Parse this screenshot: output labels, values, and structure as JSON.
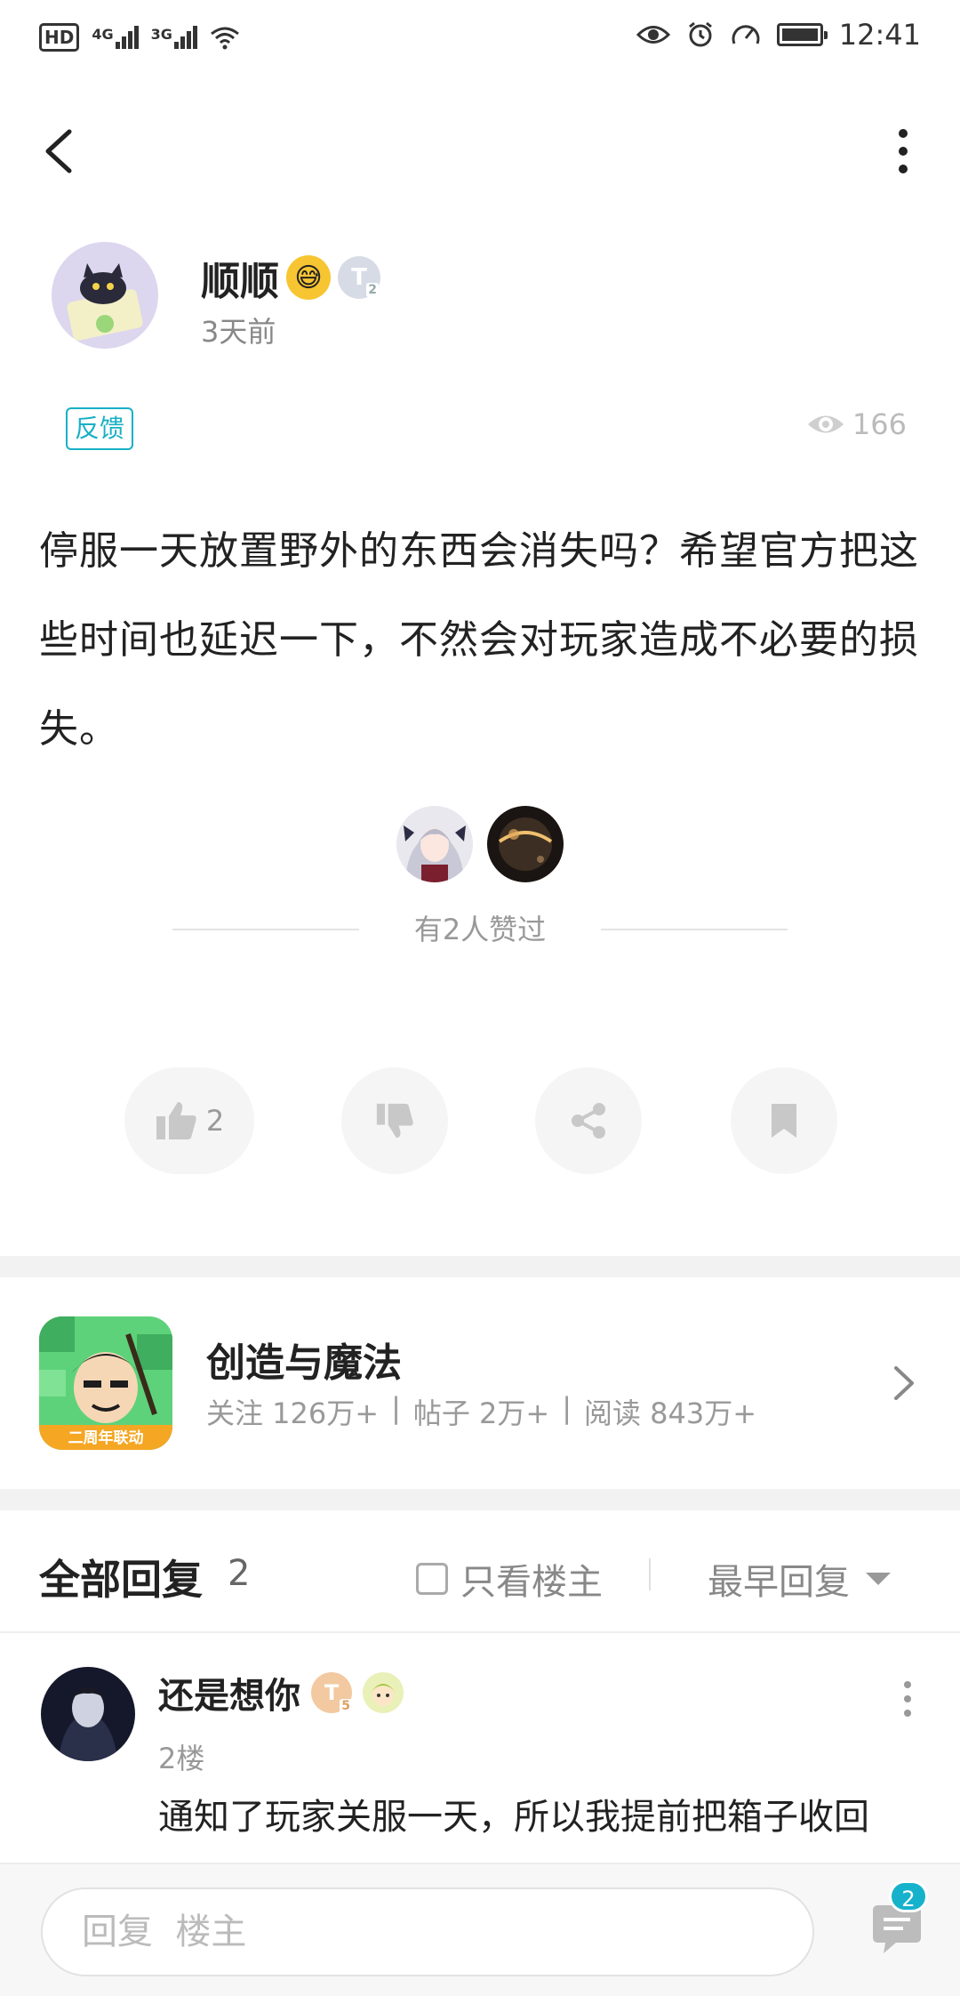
{
  "status_bar": {
    "hd": "HD",
    "sim1": "4G",
    "sim2": "3G",
    "time": "12:41"
  },
  "post": {
    "author_name": "顺顺",
    "author_emoji": "😅",
    "author_level": "T",
    "author_level_sub": "2",
    "time_ago": "3天前",
    "tag": "反馈",
    "views": "166",
    "body": "停服一天放置野外的东西会消失吗？希望官方把这些时间也延迟一下，不然会对玩家造成不必要的损失。",
    "liked_text": "有2人赞过",
    "like_count": "2"
  },
  "game": {
    "title": "创造与魔法",
    "icon_caption": "二周年联动",
    "stats": [
      "关注 126万+",
      "|",
      "帖子 2万+",
      "|",
      "阅读 843万+"
    ]
  },
  "replies": {
    "title": "全部回复",
    "count": "2",
    "owner_only": "只看楼主",
    "sort": "最早回复",
    "items": [
      {
        "name": "还是想你",
        "level": "T",
        "level_sub": "5",
        "floor": "2楼",
        "text": "通知了玩家关服一天，所以我提前把箱子收回"
      }
    ]
  },
  "bottom": {
    "placeholder": "回复  楼主",
    "comment_count": "2"
  },
  "colors": {
    "accent": "#17b0c6",
    "muted": "#999999",
    "title": "#222222"
  }
}
